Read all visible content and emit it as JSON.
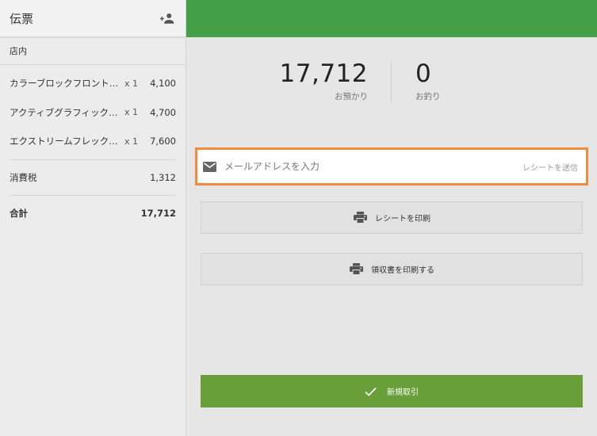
{
  "left": {
    "title": "伝票",
    "section": "店内",
    "items": [
      {
        "name": "カラーブロックフロント…",
        "qty": "x 1",
        "price": "4,100"
      },
      {
        "name": "アクティブグラフィック…",
        "qty": "x 1",
        "price": "4,700"
      },
      {
        "name": "エクストリームフレック…",
        "qty": "x 1",
        "price": "7,600"
      }
    ],
    "tax_label": "消費税",
    "tax_value": "1,312",
    "total_label": "合計",
    "total_value": "17,712"
  },
  "amounts": {
    "received_value": "17,712",
    "received_label": "お預かり",
    "change_value": "0",
    "change_label": "お釣り"
  },
  "email": {
    "placeholder": "メールアドレスを入力",
    "send_label": "レシートを送信"
  },
  "buttons": {
    "print_receipt": "レシートを印刷",
    "print_invoice": "領収書を印刷する",
    "new_transaction": "新規取引"
  },
  "colors": {
    "top_bar": "#43a047",
    "new_button": "#689f38",
    "email_border": "#f08a3c"
  },
  "icons": {
    "add_user": "add-user-icon",
    "email": "mail-icon",
    "printer": "printer-icon",
    "check": "check-icon"
  }
}
